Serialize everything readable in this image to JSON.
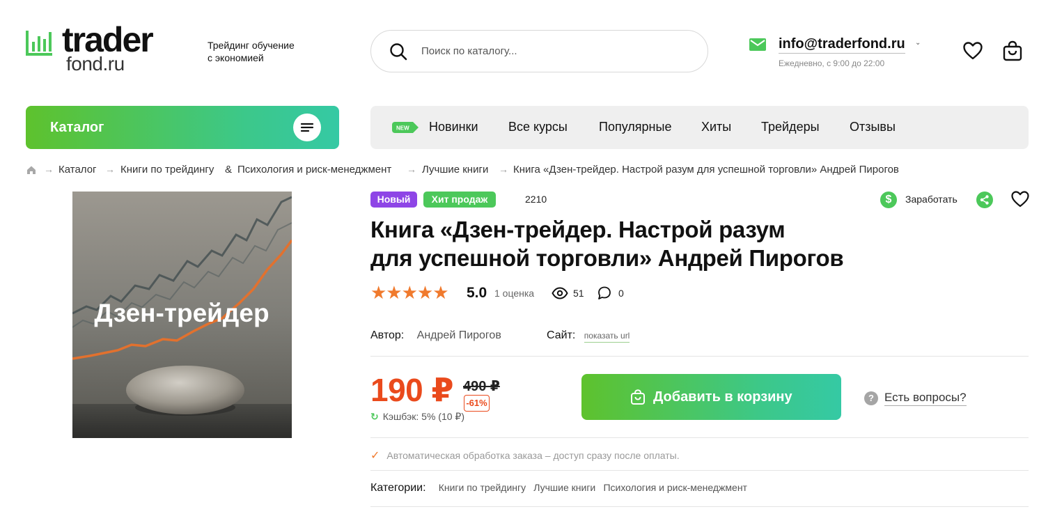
{
  "header": {
    "logo_top": "trader",
    "logo_bottom": "fond.ru",
    "tagline_line1": "Трейдинг обучение",
    "tagline_line2": "с экономией",
    "search_placeholder": "Поиск по каталогу...",
    "email": "info@traderfond.ru",
    "hours": "Ежедневно, с 9:00 до 22:00"
  },
  "nav": {
    "catalog_label": "Каталог",
    "new_badge": "NEW",
    "items": [
      "Новинки",
      "Все курсы",
      "Популярные",
      "Хиты",
      "Трейдеры",
      "Отзывы"
    ]
  },
  "breadcrumb": {
    "items": [
      "Каталог",
      "Книги по трейдингу",
      "&",
      "Психология и риск-менеджмент",
      "Лучшие книги",
      "Книга «Дзен-трейдер. Настрой разум для успешной торговли» Андрей Пирогов"
    ]
  },
  "product": {
    "image_text": "Дзен-трейдер",
    "badge_new": "Новый",
    "badge_hit": "Хит продаж",
    "sku": "2210",
    "earn_label": "Заработать",
    "title_line1": "Книга «Дзен-трейдер. Настрой разум",
    "title_line2": "для успешной торговли» Андрей Пирогов",
    "rating_stars": 5,
    "rating_value": "5.0",
    "rating_count": "1 оценка",
    "views": "51",
    "comments": "0",
    "author_label": "Автор:",
    "author_value": "Андрей Пирогов",
    "site_label": "Сайт:",
    "site_value": "показать url",
    "price": "190 ₽",
    "old_price": "490 ₽",
    "discount": "-61%",
    "cashback": "Кэшбэк: 5% (10 ₽)",
    "add_to_cart": "Добавить в корзину",
    "questions": "Есть вопросы?",
    "auto_note": "Автоматическая обработка заказа – доступ сразу после оплаты.",
    "categories_label": "Категории:",
    "categories": [
      "Книги по трейдингу",
      "Лучшие книги",
      "Психология и риск-менеджмент"
    ]
  },
  "colors": {
    "accent_green": "#4cc85a",
    "price_red": "#ea4a1c",
    "star_orange": "#f07a2d",
    "badge_purple": "#8e45e6"
  }
}
